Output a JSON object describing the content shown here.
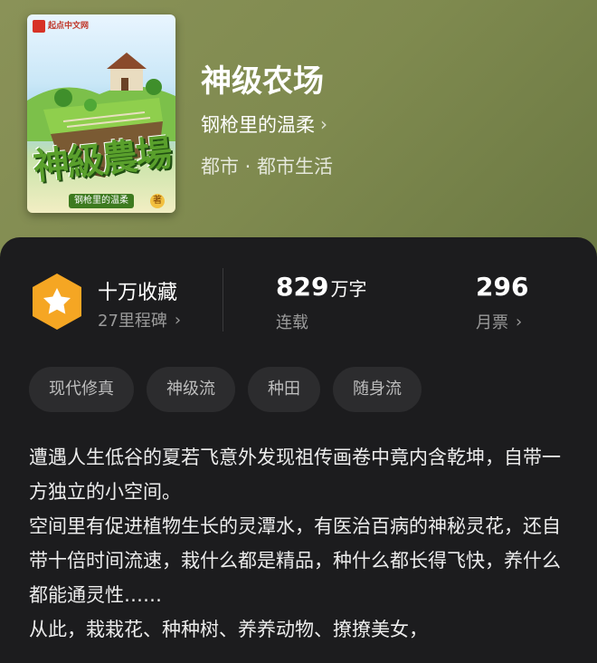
{
  "book": {
    "title": "神级农场",
    "author": "钢枪里的温柔",
    "genre": "都市 · 都市生活",
    "cover": {
      "publisher": "起点中文网",
      "title_art": "神級農場",
      "author_label": "钢枪里的温柔",
      "author_suffix": "著"
    }
  },
  "stats": {
    "favorites": {
      "label": "十万收藏",
      "sub": "27里程碑"
    },
    "words": {
      "value": "829",
      "unit": "万字",
      "sub": "连载"
    },
    "tickets": {
      "value": "296",
      "sub": "月票"
    }
  },
  "tags": [
    "现代修真",
    "神级流",
    "种田",
    "随身流"
  ],
  "intro": [
    "遭遇人生低谷的夏若飞意外发现祖传画卷中竟内含乾坤，自带一方独立的小空间。",
    "空间里有促进植物生长的灵潭水，有医治百病的神秘灵花，还自带十倍时间流速，栽什么都是精品，种什么都长得飞快，养什么都能通灵性……",
    "从此，栽栽花、种种树、养养动物、撩撩美女，"
  ],
  "colors": {
    "panel_bg": "#1c1c1e",
    "tag_bg": "#2c2c2e",
    "badge_orange": "#f5a623",
    "muted_text": "#9a9a9a"
  },
  "icons": [
    "star-badge-icon",
    "chevron-right-icon"
  ]
}
